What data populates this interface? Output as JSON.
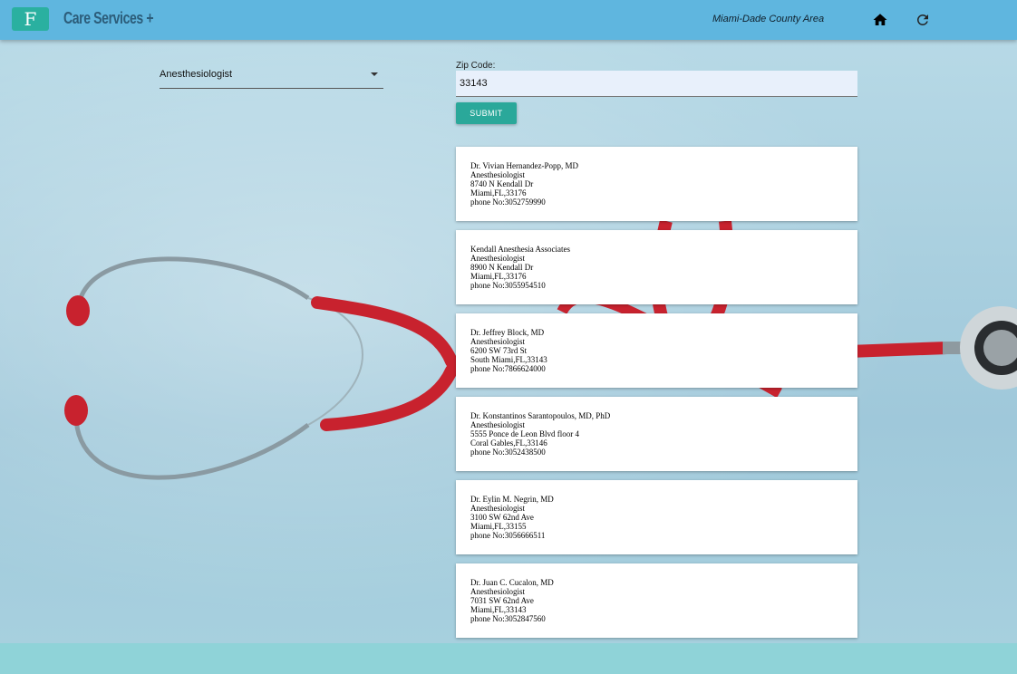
{
  "header": {
    "logo_letter": "F",
    "brand": "Care Services +",
    "area": "Miami-Dade County Area",
    "home_icon": "home-icon",
    "refresh_icon": "refresh-icon"
  },
  "form": {
    "specialty_selected": "Anesthesiologist",
    "zip_label": "Zip Code:",
    "zip_value": "33143",
    "submit_label": "SUBMIT"
  },
  "results": [
    {
      "name": "Dr. Vivian Hernandez-Popp, MD",
      "specialty": "Anesthesiologist",
      "street": "8740 N Kendall Dr",
      "city_line": "Miami,FL,33176",
      "phone": "phone No:3052759990"
    },
    {
      "name": "Kendall Anesthesia Associates",
      "specialty": "Anesthesiologist",
      "street": "8900 N Kendall Dr",
      "city_line": "Miami,FL,33176",
      "phone": "phone No:3055954510"
    },
    {
      "name": "Dr. Jeffrey Block, MD",
      "specialty": "Anesthesiologist",
      "street": "6200 SW 73rd St",
      "city_line": "South Miami,FL,33143",
      "phone": "phone No:7866624000"
    },
    {
      "name": "Dr. Konstantinos Sarantopoulos, MD, PhD",
      "specialty": "Anesthesiologist",
      "street": "5555 Ponce de Leon Blvd floor 4",
      "city_line": "Coral Gables,FL,33146",
      "phone": "phone No:3052438500"
    },
    {
      "name": "Dr. Eylin M. Negrin, MD",
      "specialty": "Anesthesiologist",
      "street": "3100 SW 62nd Ave",
      "city_line": "Miami,FL,33155",
      "phone": "phone No:3056666511"
    },
    {
      "name": "Dr. Juan C. Cucalon, MD",
      "specialty": "Anesthesiologist",
      "street": "7031 SW 62nd Ave",
      "city_line": "Miami,FL,33143",
      "phone": "phone No:3052847560"
    }
  ]
}
